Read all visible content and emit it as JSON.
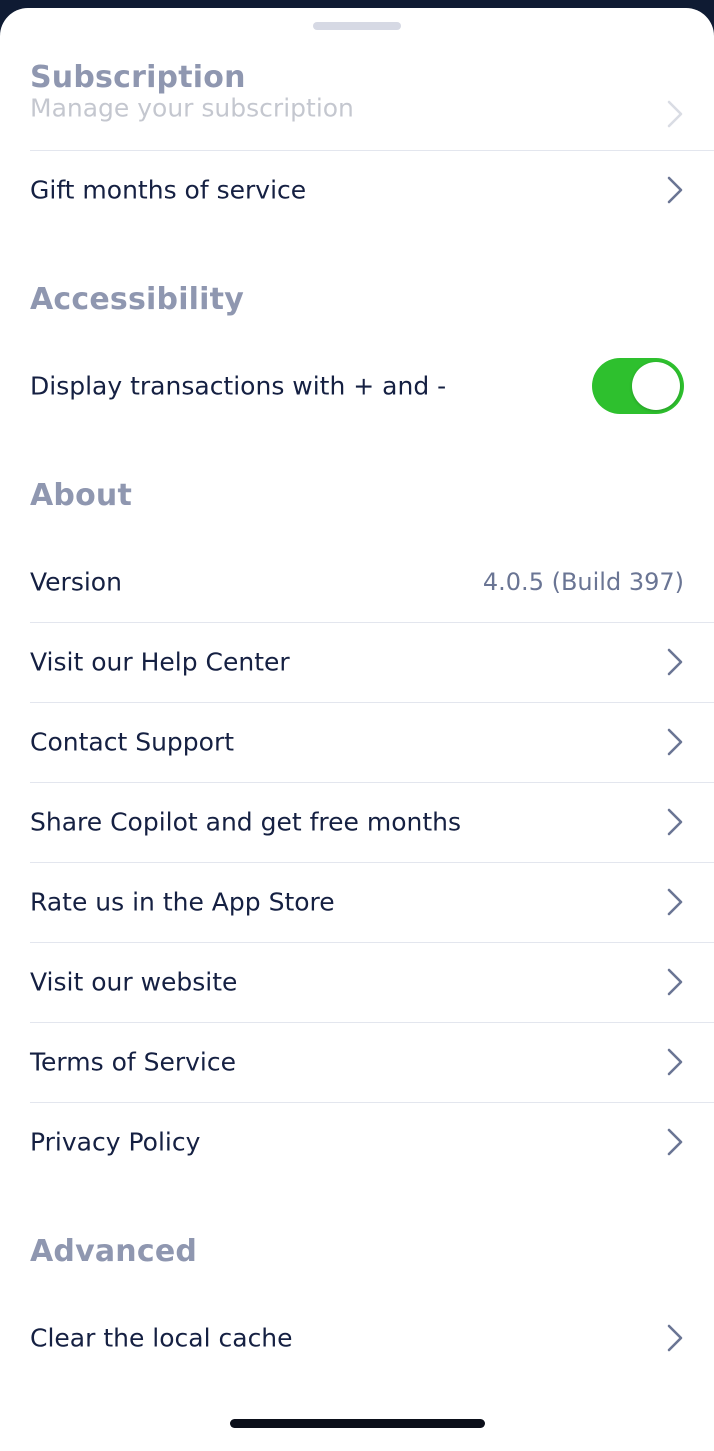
{
  "sections": {
    "subscription": {
      "title": "Subscription",
      "faded_item": "Manage your subscription",
      "gift_item": "Gift months of service"
    },
    "accessibility": {
      "title": "Accessibility",
      "toggle_label": "Display transactions with + and -",
      "toggle_on": true,
      "toggle_color": "#2ec02e"
    },
    "about": {
      "title": "About",
      "version_label": "Version",
      "version_value": "4.0.5 (Build 397)",
      "items": [
        "Visit our Help Center",
        "Contact Support",
        "Share Copilot and get free months",
        "Rate us in the App Store",
        "Visit our website",
        "Terms of Service",
        "Privacy Policy"
      ]
    },
    "advanced": {
      "title": "Advanced",
      "items": [
        "Clear the local cache"
      ]
    }
  },
  "icons": {
    "row_chevron": "chevron-right-icon"
  }
}
